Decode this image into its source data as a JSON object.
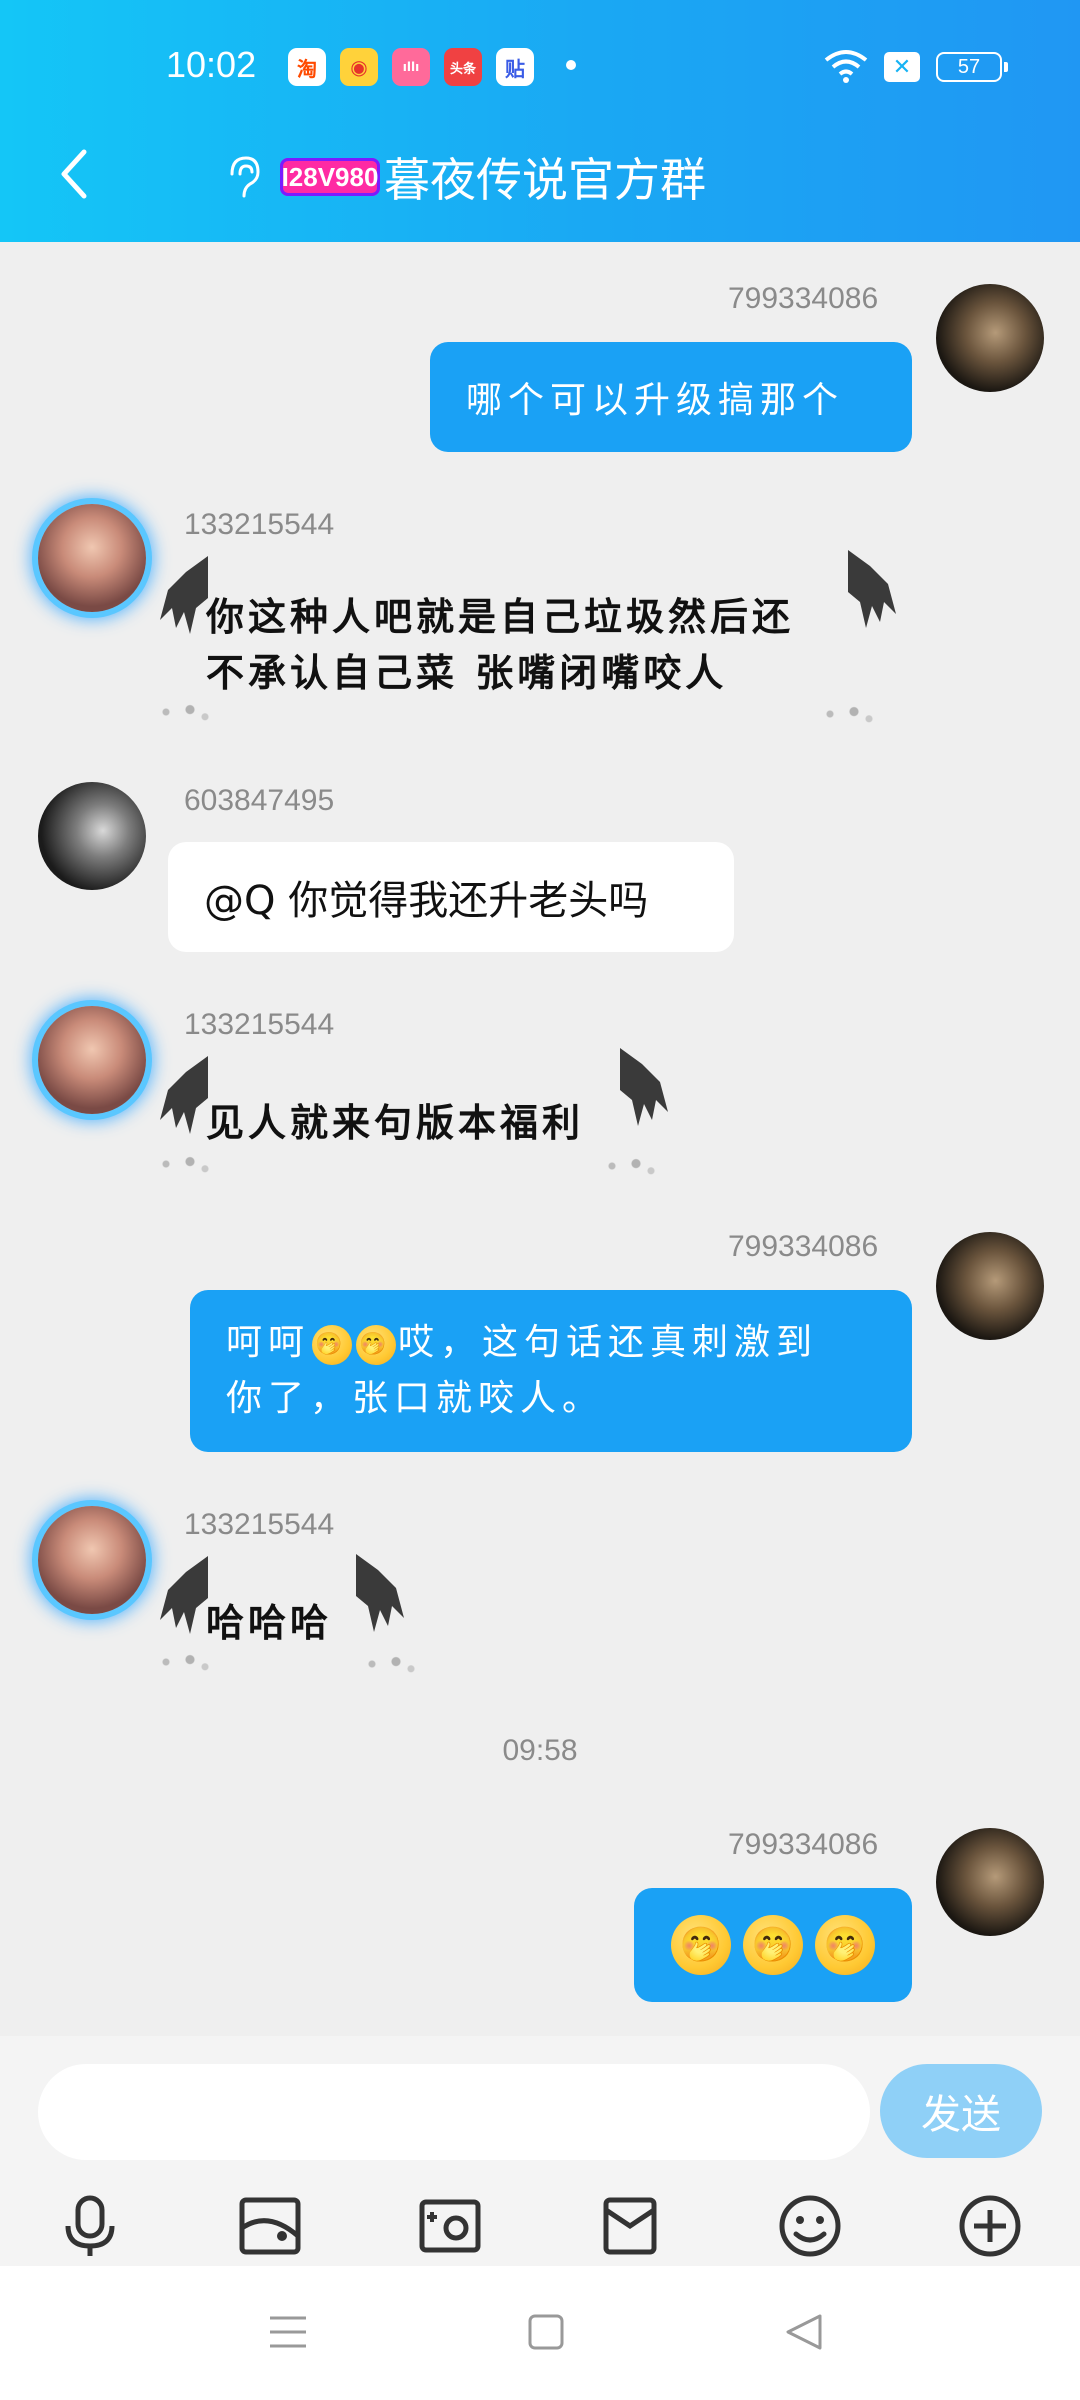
{
  "status_bar": {
    "time": "10:02",
    "battery": "57",
    "apps": [
      "taobao-icon",
      "weibo-icon",
      "bilibili-icon",
      "toutiao-icon",
      "tieba-icon"
    ]
  },
  "header": {
    "badge": "I28V980",
    "title": "暮夜传说官方群"
  },
  "messages": [
    {
      "id": "799334086",
      "text": "哪个可以升级搞那个"
    },
    {
      "id": "133215544",
      "line1": "你这种人吧就是自己垃圾然后还",
      "line2": "不承认自己菜 张嘴闭嘴咬人"
    },
    {
      "id": "603847495",
      "text": "@Q 你觉得我还升老头吗"
    },
    {
      "id": "133215544",
      "text": "见人就来句版本福利"
    },
    {
      "id": "799334086",
      "line1_prefix": "呵呵",
      "line1_suffix": "哎，这句话还真刺激到",
      "line2": "你了，张口就咬人。"
    },
    {
      "id": "133215544",
      "text": "哈哈哈"
    },
    {
      "time_separator": "09:58"
    },
    {
      "id": "799334086",
      "emoji": "🤭"
    }
  ],
  "input": {
    "placeholder": "",
    "send_label": "发送"
  },
  "colors": {
    "header_gradient_start": "#14c6f7",
    "header_gradient_end": "#2097f3",
    "bubble_blue": "#1aa1f5",
    "send_button": "#8fd0f7"
  }
}
